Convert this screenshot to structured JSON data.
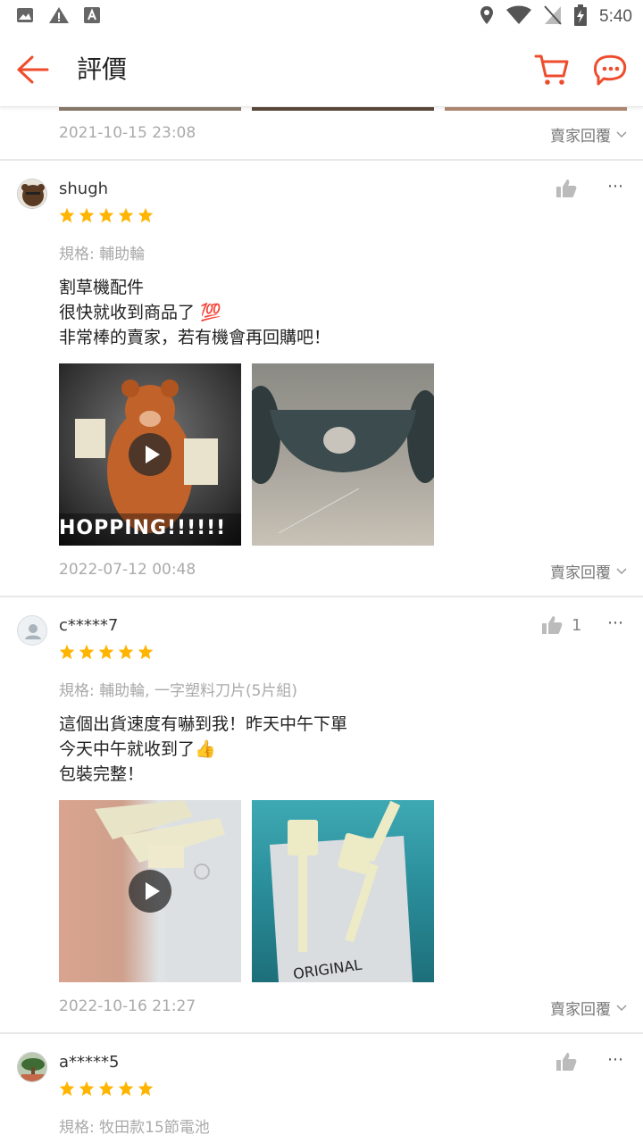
{
  "status_bar": {
    "time": "5:40"
  },
  "header": {
    "title": "評價"
  },
  "prev_review": {
    "date": "2021-10-15 23:08",
    "reply_label": "賣家回覆"
  },
  "reviews": [
    {
      "username": "shugh",
      "rating": 5,
      "variant": "規格: 輔助輪",
      "lines": [
        "割草機配件",
        "很快就收到商品了 💯",
        "非常棒的賣家，若有機會再回購吧！"
      ],
      "video_caption": "HOPPING!!!!!!",
      "like_count": "",
      "date": "2022-07-12 00:48",
      "reply_label": "賣家回覆"
    },
    {
      "username": "c*****7",
      "rating": 5,
      "variant": "規格: 輔助輪, 一字塑料刀片(5片組)",
      "lines": [
        "這個出貨速度有嚇到我！昨天中午下單",
        "今天中午就收到了👍",
        "包裝完整！"
      ],
      "photo_caption": "ORIGINAL",
      "like_count": "1",
      "date": "2022-10-16 21:27",
      "reply_label": "賣家回覆"
    },
    {
      "username": "a*****5",
      "rating": 5,
      "variant": "規格: 牧田款15節電池",
      "like_count": ""
    }
  ],
  "colors": {
    "accent": "#ee4d2d",
    "star": "#ffb400"
  }
}
